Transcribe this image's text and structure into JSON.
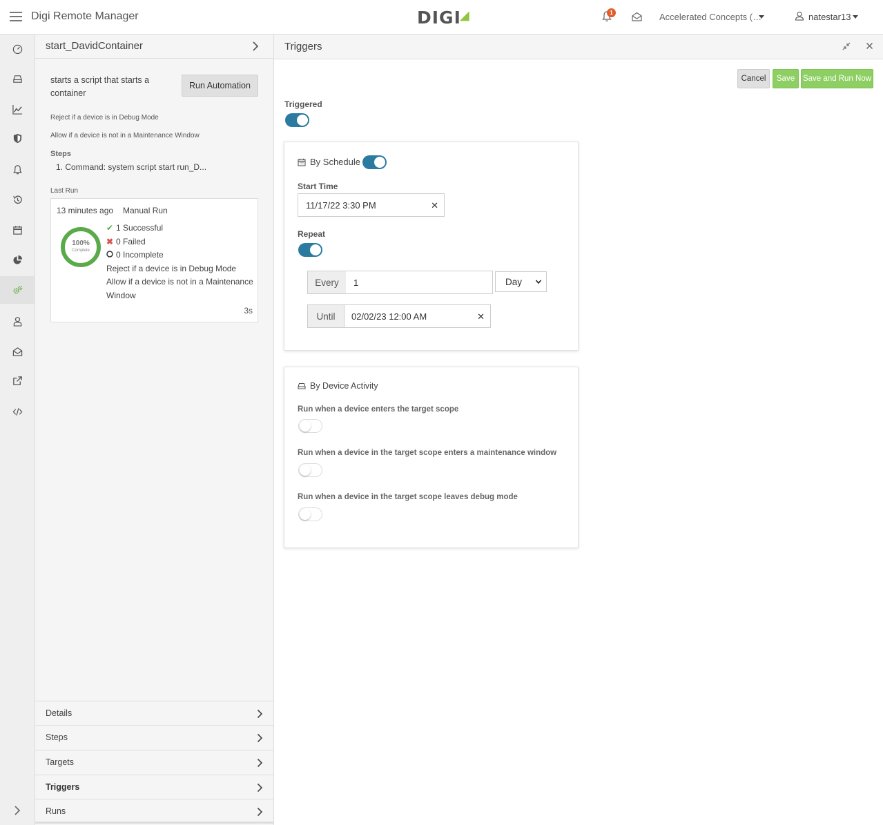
{
  "app": {
    "title": "Digi Remote Manager",
    "logo": "DIGI",
    "notif_count": "1"
  },
  "header": {
    "org": "Accelerated Concepts (…",
    "user": "natestar13"
  },
  "automation": {
    "name": "start_DavidContainer",
    "description": "starts a script that starts a container",
    "run_button": "Run Automation",
    "rule1": "Reject if a device is in Debug Mode",
    "rule2": "Allow if a device is not in a Maintenance Window",
    "steps_label": "Steps",
    "step1": "1. Command: system script start run_D...",
    "last_run_label": "Last Run",
    "last_run": {
      "ago": "13 minutes ago",
      "type": "Manual Run",
      "percent_text": "100%",
      "percent_sub": "Complete",
      "percent": 100,
      "successful": "1 Successful",
      "failed": "0 Failed",
      "incomplete": "0 Incomplete",
      "rule1": "Reject if a device is in Debug Mode",
      "rule2a": "Allow if a device is not in a Maintenance",
      "rule2b": "Window",
      "duration": "3s"
    },
    "sections": [
      "Details",
      "Steps",
      "Targets",
      "Triggers",
      "Runs"
    ]
  },
  "triggers": {
    "title": "Triggers",
    "cancel": "Cancel",
    "save": "Save",
    "save_run": "Save and Run Now",
    "triggered_label": "Triggered",
    "triggered": true,
    "schedule": {
      "title": "By Schedule",
      "enabled": true,
      "start_label": "Start Time",
      "start_value": "11/17/22 3:30 PM",
      "repeat_label": "Repeat",
      "repeat": true,
      "every_label": "Every",
      "every_value": "1",
      "unit": "Day",
      "until_label": "Until",
      "until_value": "02/02/23 12:00 AM"
    },
    "device_activity": {
      "title": "By Device Activity",
      "opt1": "Run when a device enters the target scope",
      "opt2": "Run when a device in the target scope enters a maintenance window",
      "opt3": "Run when a device in the target scope leaves debug mode"
    }
  },
  "colors": {
    "accent": "#2b7ba0",
    "green": "#8dcf62",
    "success": "#5aaa4a",
    "danger": "#d9534f"
  }
}
